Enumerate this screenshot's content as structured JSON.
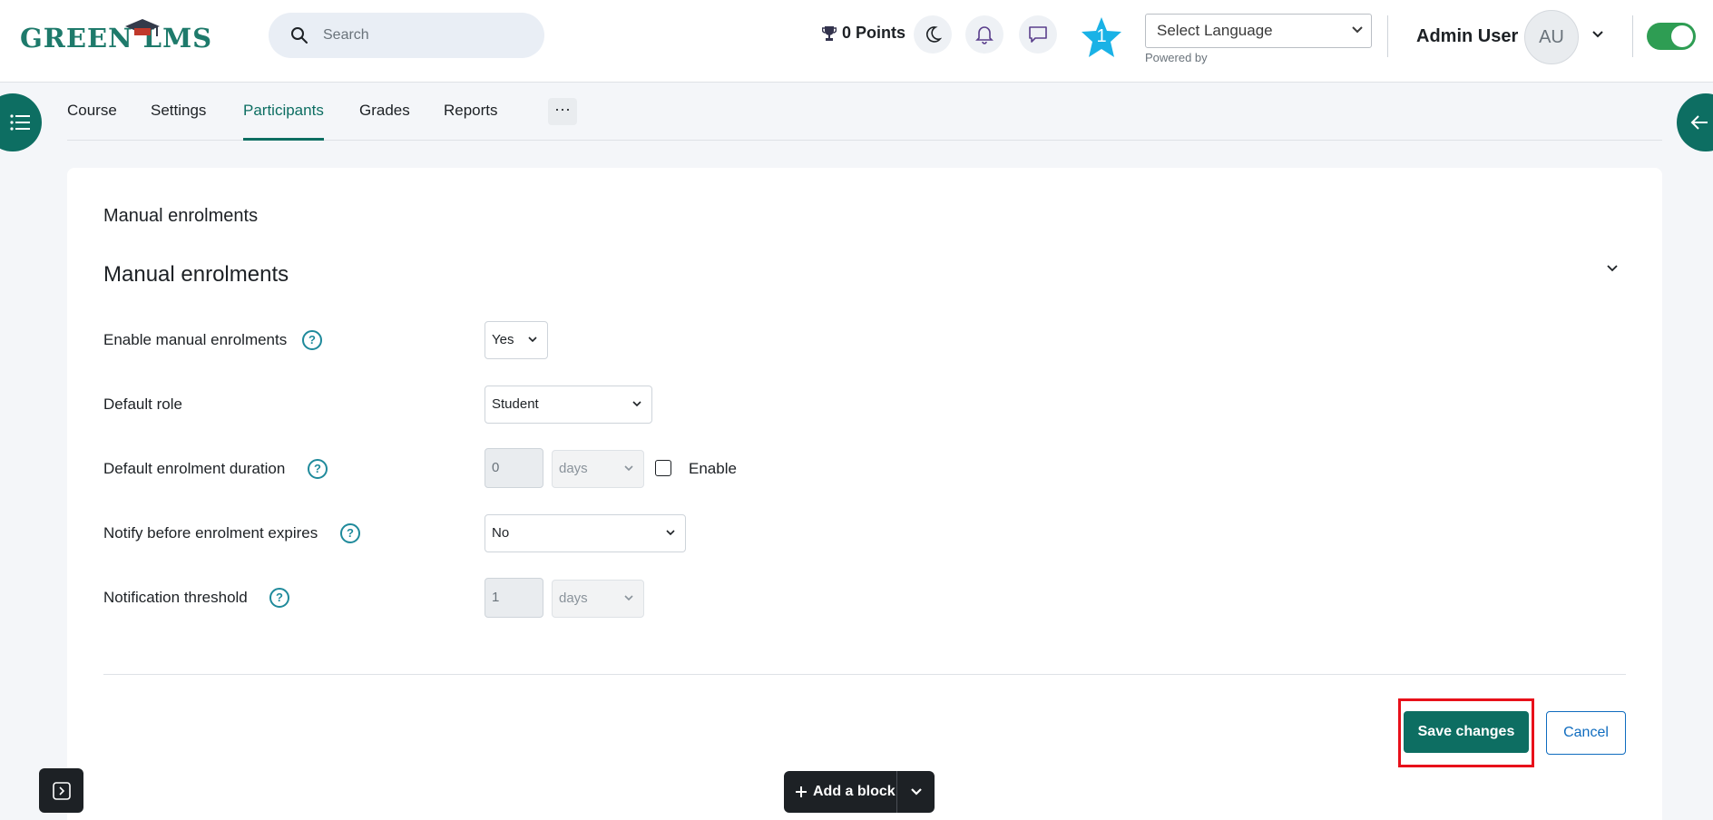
{
  "header": {
    "logo_text": "GREEN LMS",
    "search_placeholder": "Search",
    "points_label": "0 Points",
    "star_badge": "1",
    "language_select": "Select Language",
    "powered_by": "Powered by",
    "user_name": "Admin User",
    "user_initials": "AU"
  },
  "tabs": [
    {
      "label": "Course"
    },
    {
      "label": "Settings"
    },
    {
      "label": "Participants"
    },
    {
      "label": "Grades"
    },
    {
      "label": "Reports"
    },
    {
      "label": "···"
    }
  ],
  "active_tab": "Participants",
  "page": {
    "heading": "Manual enrolments",
    "section_heading": "Manual enrolments"
  },
  "form": {
    "enable_manual": {
      "label": "Enable manual enrolments",
      "value": "Yes"
    },
    "default_role": {
      "label": "Default role",
      "value": "Student"
    },
    "duration": {
      "label": "Default enrolment duration",
      "value": "0",
      "unit": "days",
      "enable_label": "Enable",
      "enabled": false
    },
    "notify": {
      "label": "Notify before enrolment expires",
      "value": "No"
    },
    "threshold": {
      "label": "Notification threshold",
      "value": "1",
      "unit": "days"
    }
  },
  "help_symbol": "?",
  "actions": {
    "save": "Save changes",
    "cancel": "Cancel",
    "add_block": "Add a block"
  },
  "colors": {
    "brand": "#0d6e62",
    "link": "#0f6cbf",
    "highlight": "#e8101a",
    "toggle_on": "#2e9d53",
    "star": "#1ab2e6"
  }
}
